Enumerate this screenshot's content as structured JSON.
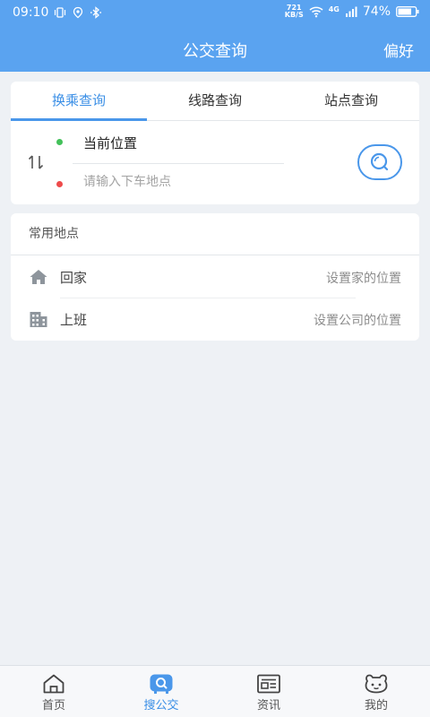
{
  "status_bar": {
    "time": "09:10",
    "net_speed_value": "721",
    "net_speed_unit": "KB/S",
    "signal_label": "4G",
    "battery": "74%"
  },
  "header": {
    "title": "公交查询",
    "action": "偏好"
  },
  "tabs": [
    {
      "label": "换乘查询",
      "active": true
    },
    {
      "label": "线路查询",
      "active": false
    },
    {
      "label": "站点查询",
      "active": false
    }
  ],
  "search": {
    "from_value": "当前位置",
    "to_placeholder": "请输入下车地点"
  },
  "places": {
    "title": "常用地点",
    "items": [
      {
        "label": "回家",
        "action": "设置家的位置",
        "icon": "home-icon"
      },
      {
        "label": "上班",
        "action": "设置公司的位置",
        "icon": "building-icon"
      }
    ]
  },
  "bottom_nav": [
    {
      "label": "首页",
      "icon": "home-icon",
      "active": false
    },
    {
      "label": "搜公交",
      "icon": "search-bus-icon",
      "active": true
    },
    {
      "label": "资讯",
      "icon": "news-icon",
      "active": false
    },
    {
      "label": "我的",
      "icon": "profile-icon",
      "active": false
    }
  ],
  "colors": {
    "accent": "#5aa3f0",
    "active_text": "#3b8fe6",
    "start_dot": "#43c15a",
    "end_dot": "#ee4b4b",
    "background": "#eef1f5"
  }
}
